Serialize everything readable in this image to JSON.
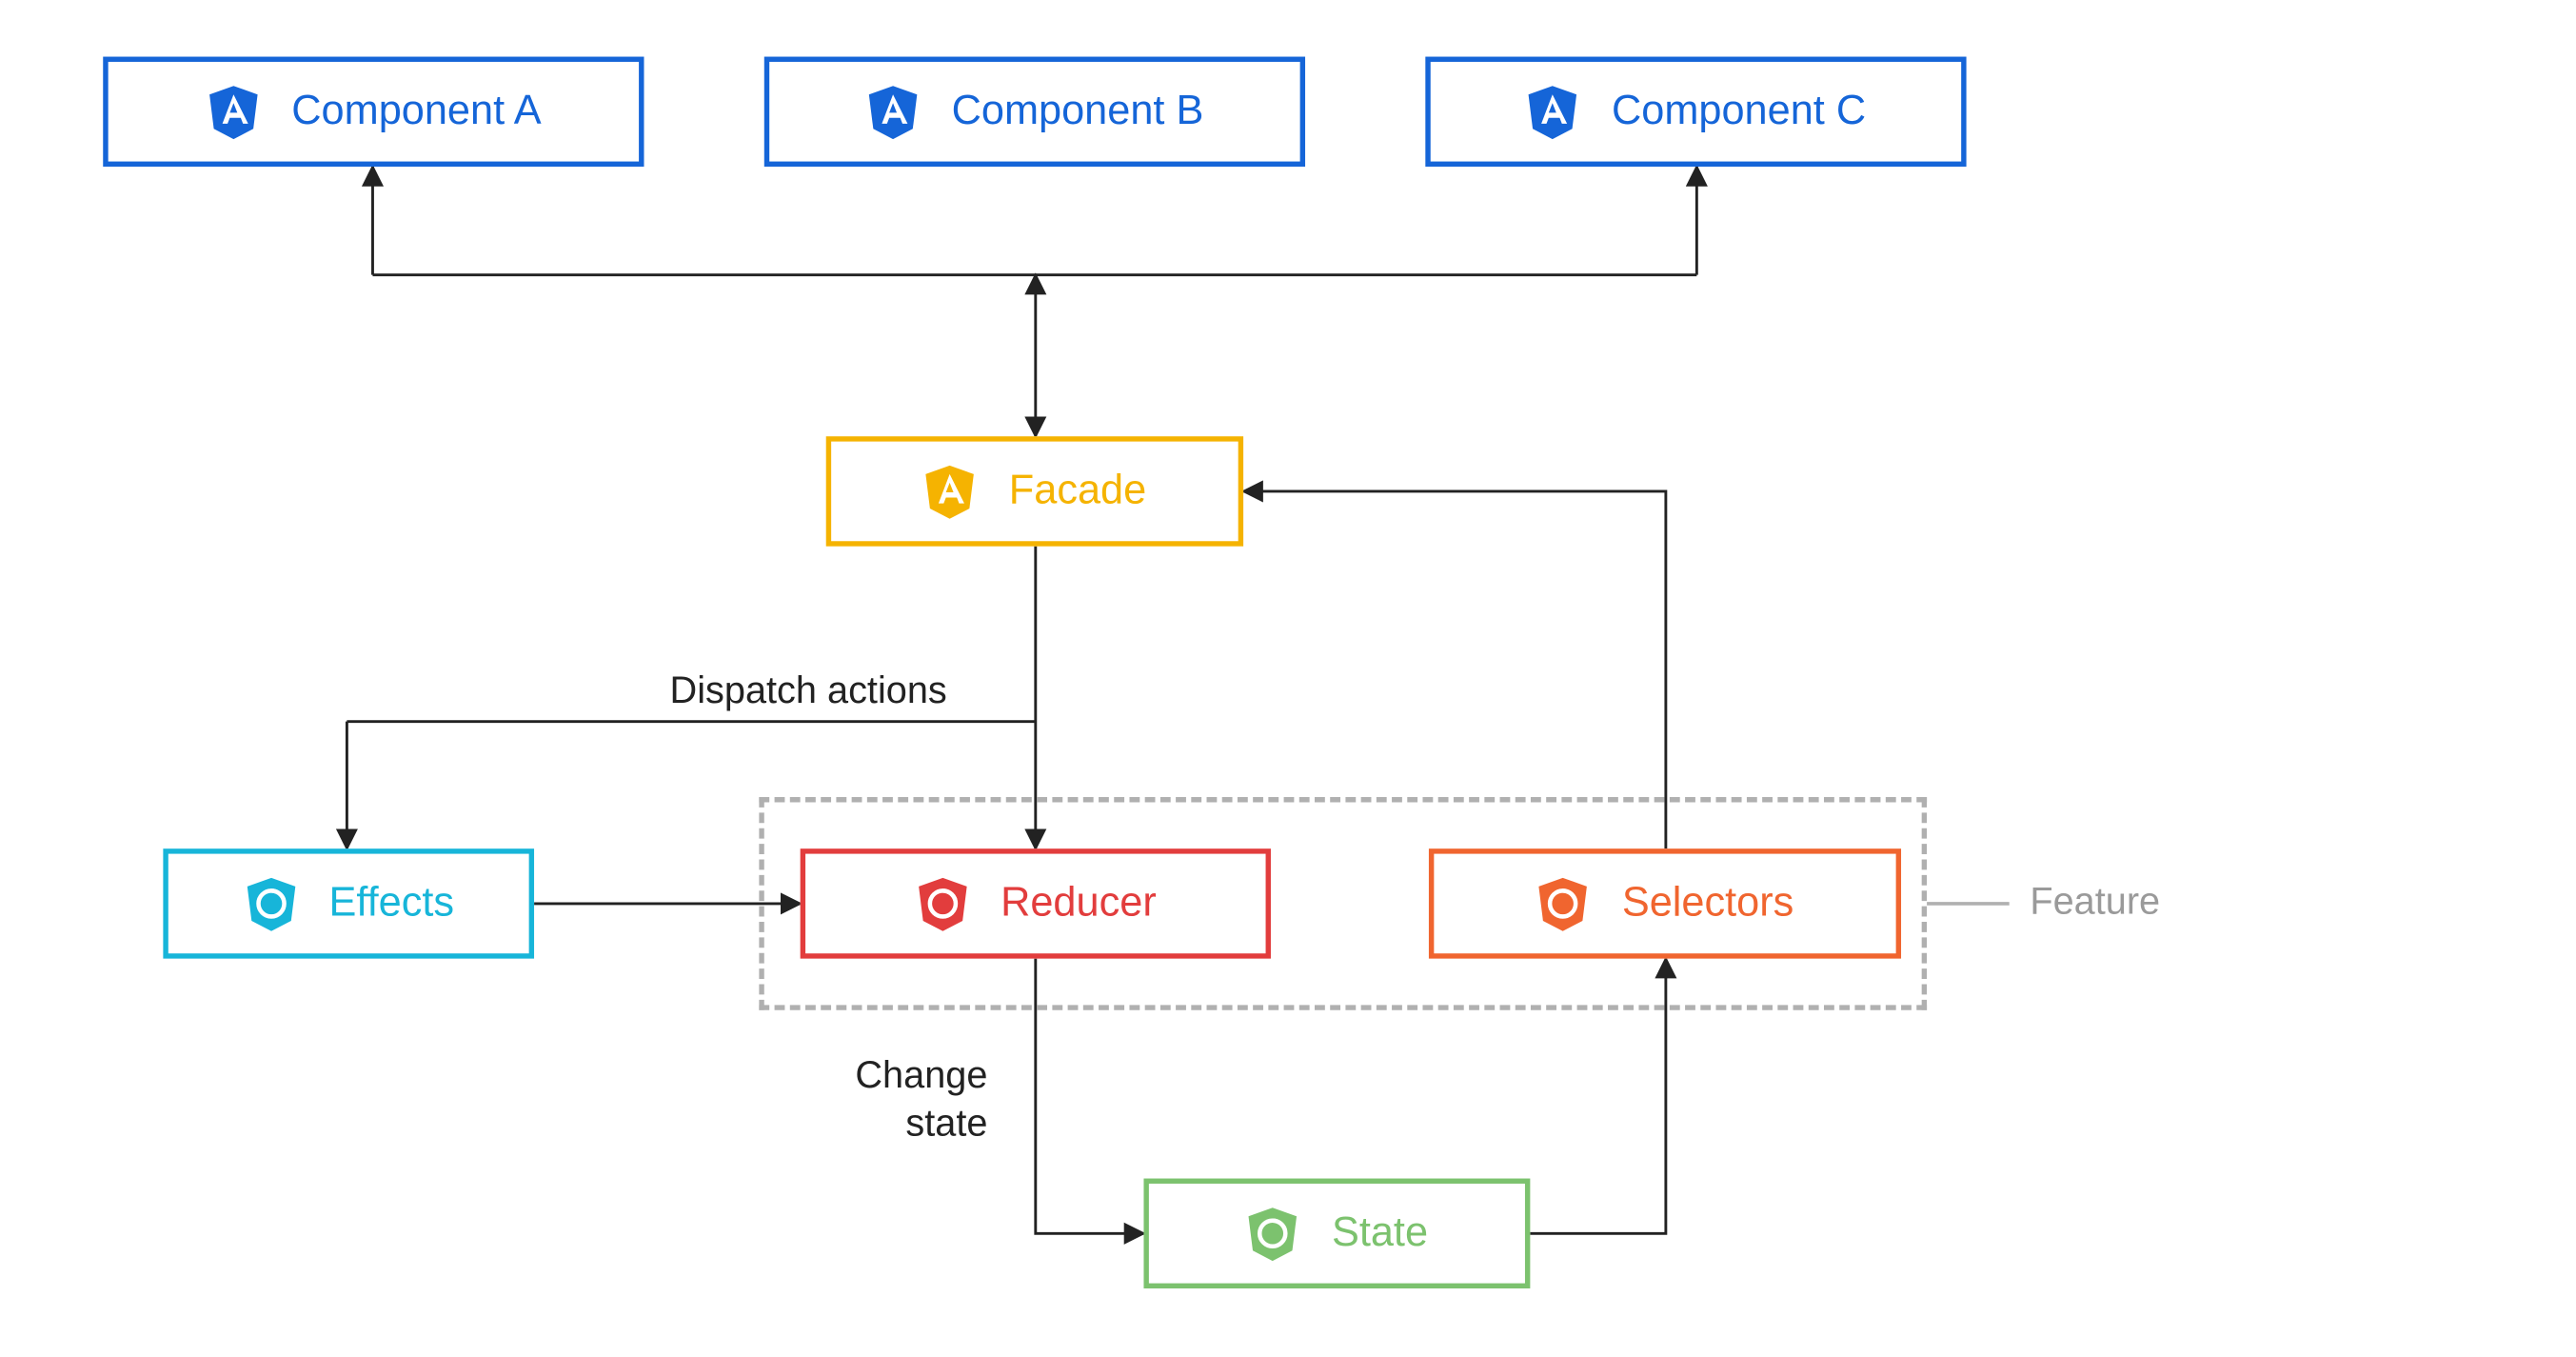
{
  "nodes": {
    "componentA": "Component A",
    "componentB": "Component B",
    "componentC": "Component C",
    "facade": "Facade",
    "effects": "Effects",
    "reducer": "Reducer",
    "selectors": "Selectors",
    "state": "State"
  },
  "labels": {
    "dispatch": "Dispatch actions",
    "changeState": "Change\nstate",
    "feature": "Feature"
  },
  "colors": {
    "blue": "#1565d8",
    "yellow": "#f5b301",
    "cyan": "#17b5d9",
    "red": "#e23d3d",
    "orange": "#f0652f",
    "green": "#7cc26e",
    "gray": "#b0b0b0",
    "text": "#222222"
  },
  "icons": {
    "angular": "angular-icon",
    "ngrx": "ngrx-icon"
  },
  "edges": [
    {
      "from": "facade",
      "to": "componentA",
      "style": "arrow"
    },
    {
      "from": "facade",
      "to": "componentB",
      "style": "arrow-both"
    },
    {
      "from": "facade",
      "to": "componentC",
      "style": "arrow"
    },
    {
      "from": "facade",
      "to": "reducer",
      "label": "Dispatch actions",
      "style": "arrow"
    },
    {
      "from": "facade",
      "to": "effects",
      "style": "arrow"
    },
    {
      "from": "effects",
      "to": "reducer",
      "style": "arrow"
    },
    {
      "from": "reducer",
      "to": "state",
      "label": "Change state",
      "style": "arrow"
    },
    {
      "from": "state",
      "to": "selectors",
      "style": "arrow"
    },
    {
      "from": "selectors",
      "to": "facade",
      "style": "arrow"
    }
  ],
  "groups": {
    "feature": [
      "reducer",
      "selectors"
    ]
  }
}
